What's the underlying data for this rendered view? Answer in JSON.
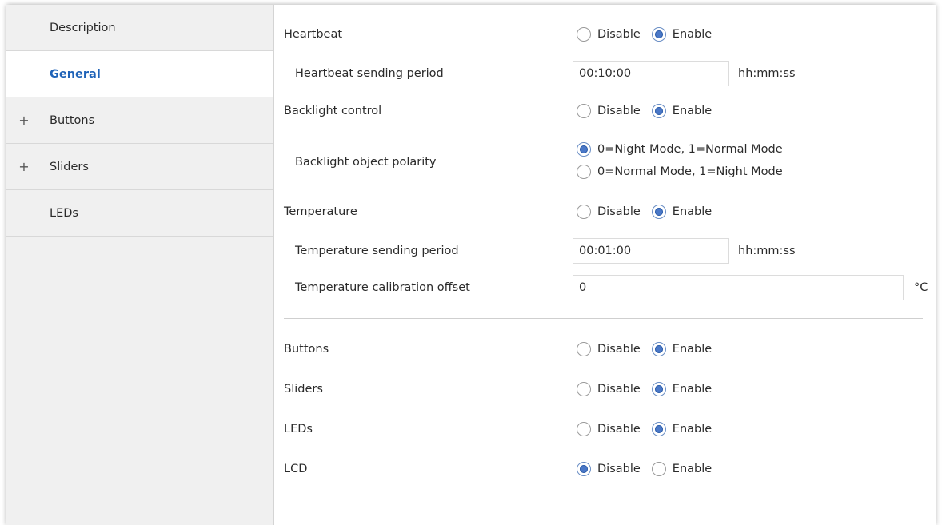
{
  "sidebar": {
    "items": [
      {
        "label": "Description",
        "prefix": ""
      },
      {
        "label": "General",
        "prefix": ""
      },
      {
        "label": "Buttons",
        "prefix": "+"
      },
      {
        "label": "Sliders",
        "prefix": "+"
      },
      {
        "label": "LEDs",
        "prefix": ""
      }
    ],
    "active_index": 1
  },
  "options": {
    "disable": "Disable",
    "enable": "Enable"
  },
  "general": {
    "heartbeat": {
      "label": "Heartbeat",
      "selected": "Enable"
    },
    "heartbeat_period": {
      "label": "Heartbeat sending period",
      "value": "00:10:00",
      "unit": "hh:mm:ss"
    },
    "backlight": {
      "label": "Backlight control",
      "selected": "Enable"
    },
    "backlight_polarity": {
      "label": "Backlight object polarity",
      "options": [
        "0=Night Mode, 1=Normal Mode",
        "0=Normal Mode, 1=Night Mode"
      ],
      "selected_index": 0
    },
    "temperature": {
      "label": "Temperature",
      "selected": "Enable"
    },
    "temperature_period": {
      "label": "Temperature sending period",
      "value": "00:01:00",
      "unit": "hh:mm:ss"
    },
    "temperature_offset": {
      "label": "Temperature calibration offset",
      "value": "0",
      "unit": "°C"
    },
    "buttons": {
      "label": "Buttons",
      "selected": "Enable"
    },
    "sliders": {
      "label": "Sliders",
      "selected": "Enable"
    },
    "leds": {
      "label": "LEDs",
      "selected": "Enable"
    },
    "lcd": {
      "label": "LCD",
      "selected": "Disable"
    }
  },
  "colors": {
    "accent": "#1f63b8",
    "radio_selected": "#4a78c8",
    "sidebar_bg": "#f0f0f0"
  }
}
